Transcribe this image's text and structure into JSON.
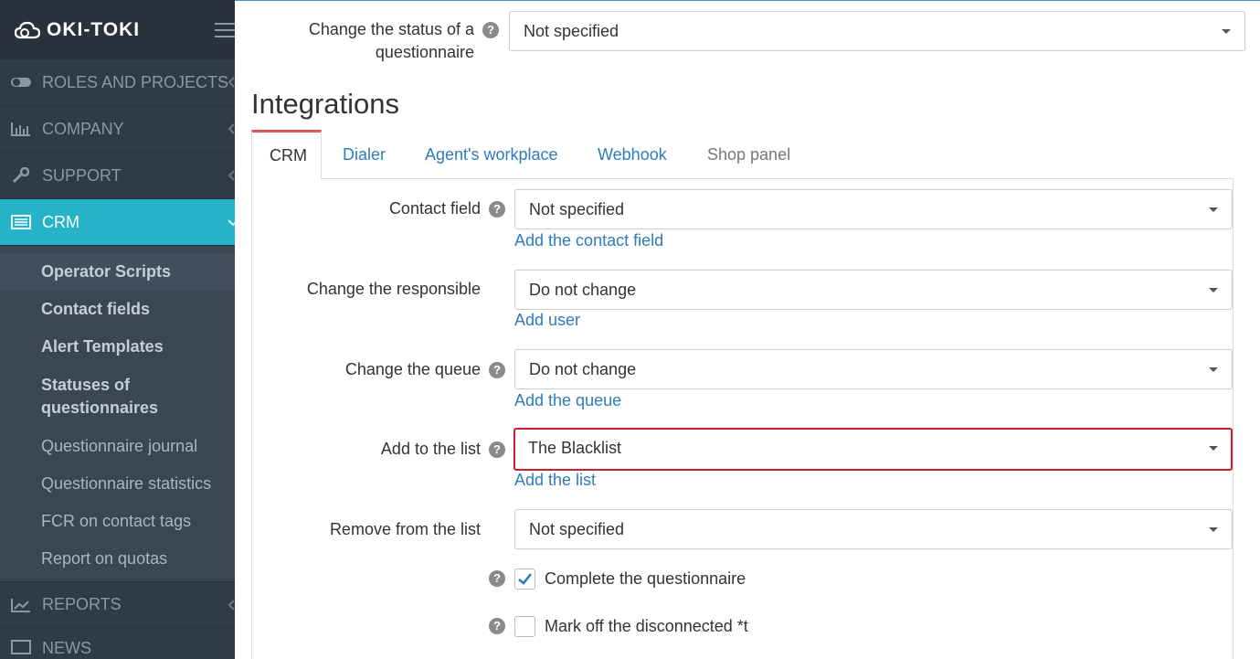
{
  "app": {
    "logo_text": "OKI-TOKI"
  },
  "sidebar": {
    "items": [
      {
        "label": "ROLES AND PROJECTS",
        "icon": "toggle-icon"
      },
      {
        "label": "COMPANY",
        "icon": "bar-chart-icon"
      },
      {
        "label": "SUPPORT",
        "icon": "wrench-icon"
      },
      {
        "label": "CRM",
        "icon": "list-icon",
        "active": true
      },
      {
        "label": "REPORTS",
        "icon": "line-chart-icon"
      },
      {
        "label": "NEWS",
        "icon": "news-icon"
      }
    ],
    "crm_subitems": [
      {
        "label": "Operator Scripts"
      },
      {
        "label": "Contact fields"
      },
      {
        "label": "Alert Templates"
      },
      {
        "label": "Statuses of questionnaires"
      },
      {
        "label": "Questionnaire journal"
      },
      {
        "label": "Questionnaire statistics"
      },
      {
        "label": "FCR on contact tags"
      },
      {
        "label": "Report on quotas"
      }
    ]
  },
  "form_top": {
    "status_label": "Change the status of a questionnaire",
    "status_value": "Not specified"
  },
  "integrations": {
    "title": "Integrations",
    "tabs": [
      {
        "label": "CRM"
      },
      {
        "label": "Dialer"
      },
      {
        "label": "Agent's workplace"
      },
      {
        "label": "Webhook"
      },
      {
        "label": "Shop panel"
      }
    ],
    "crm": {
      "contact_field": {
        "label": "Contact field",
        "value": "Not specified",
        "link": "Add the contact field"
      },
      "responsible": {
        "label": "Change the responsible",
        "value": "Do not change",
        "link": "Add user"
      },
      "queue": {
        "label": "Change the queue",
        "value": "Do not change",
        "link": "Add the queue"
      },
      "add_list": {
        "label": "Add to the list",
        "value": "The Blacklist",
        "link": "Add the list"
      },
      "remove_list": {
        "label": "Remove from the list",
        "value": "Not specified"
      },
      "complete_questionnaire": {
        "label": "Complete the questionnaire",
        "checked": true
      },
      "mark_disconnected": {
        "label": "Mark off the disconnected *t",
        "checked": false
      }
    }
  },
  "colors": {
    "sidebar_bg": "#2f3c48",
    "active_nav": "#26b3c7",
    "link": "#2f7bbf",
    "highlight_border": "#cc1f2e",
    "tab_accent": "#e05a5a"
  }
}
